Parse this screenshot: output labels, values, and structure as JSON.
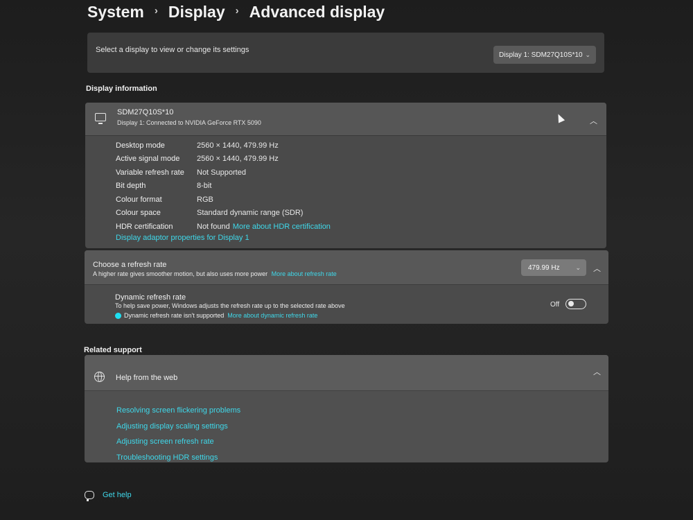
{
  "breadcrumb": {
    "items": [
      "System",
      "Display",
      "Advanced display"
    ],
    "separator": "›"
  },
  "select_display": {
    "label": "Select a display to view or change its settings",
    "dropdown_value": "Display 1: SDM27Q10S*10"
  },
  "display_information": {
    "section_title": "Display information",
    "monitor_name": "SDM27Q10S*10",
    "monitor_subtitle": "Display 1: Connected to NVIDIA GeForce RTX 5090",
    "rows": [
      {
        "key": "Desktop mode",
        "value": "2560 × 1440, 479.99 Hz"
      },
      {
        "key": "Active signal mode",
        "value": "2560 × 1440, 479.99 Hz"
      },
      {
        "key": "Variable refresh rate",
        "value": "Not Supported"
      },
      {
        "key": "Bit depth",
        "value": "8-bit"
      },
      {
        "key": "Colour format",
        "value": "RGB"
      },
      {
        "key": "Colour space",
        "value": "Standard dynamic range (SDR)"
      },
      {
        "key": "HDR certification",
        "value": "Not found",
        "link": "More about HDR certification"
      }
    ],
    "adaptor_link": "Display adaptor properties for Display 1"
  },
  "refresh_rate": {
    "title": "Choose a refresh rate",
    "subtitle": "A higher rate gives smoother motion, but also uses more power",
    "subtitle_link": "More about refresh rate",
    "value": "479.99 Hz",
    "dynamic": {
      "title": "Dynamic refresh rate",
      "subtitle": "To help save power, Windows adjusts the refresh rate up to the selected rate above",
      "note": "Dynamic refresh rate isn't supported",
      "note_link": "More about dynamic refresh rate",
      "toggle_label": "Off"
    }
  },
  "related_support": {
    "section_title": "Related support",
    "help_title": "Help from the web",
    "links": [
      "Resolving screen flickering problems",
      "Adjusting display scaling settings",
      "Adjusting screen refresh rate",
      "Troubleshooting HDR settings"
    ]
  },
  "get_help": "Get help",
  "colors": {
    "accent_link": "#3fd8ea",
    "background": "#1c1c1c",
    "card": "#4a4a4a"
  },
  "icons": [
    "monitor-icon",
    "chevron-up-icon",
    "chevron-down-icon",
    "globe-icon",
    "chat-help-icon",
    "mouse-cursor-icon"
  ]
}
